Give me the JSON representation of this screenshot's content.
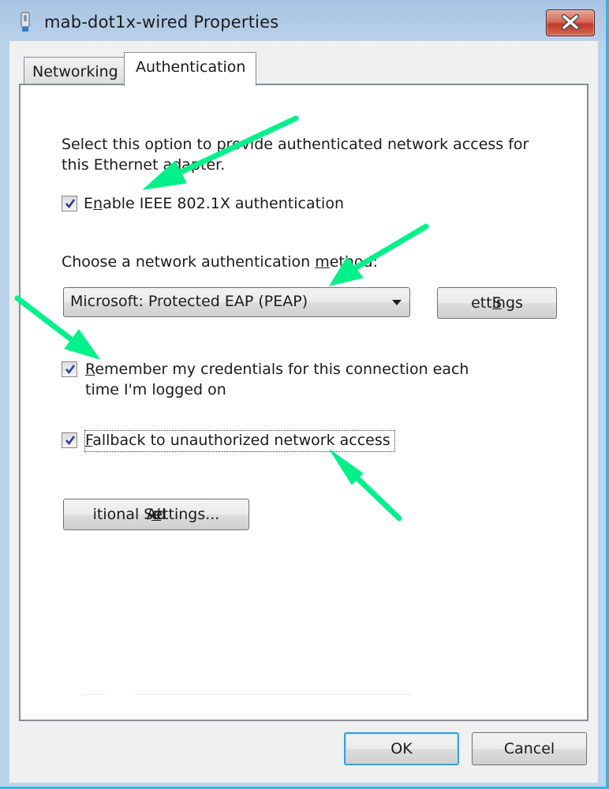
{
  "window": {
    "title": "mab-dot1x-wired Properties",
    "icon": "network-adapter-icon",
    "close_icon": "close-icon"
  },
  "tabs": [
    {
      "label": "Networking",
      "selected": false
    },
    {
      "label": "Authentication",
      "selected": true
    }
  ],
  "auth": {
    "description_line1": "Select this option to provide authenticated network access for",
    "description_line2": "this Ethernet adapter.",
    "enable_8021x": {
      "label_pre": "E",
      "label_accel": "n",
      "label_post": "able IEEE 802.1X authentication",
      "checked": true
    },
    "method_label_pre": "Choose a network authentication ",
    "method_label_accel": "m",
    "method_label_post": "ethod:",
    "method_selected": "Microsoft: Protected EAP (PEAP)",
    "settings_button": {
      "accel": "S",
      "rest": "ettings"
    },
    "remember_credentials": {
      "label_accel": "R",
      "label_line1_rest": "emember my credentials for this connection each",
      "label_line2": "time I'm logged on",
      "checked": true
    },
    "fallback": {
      "label_accel": "F",
      "label_rest": "allback to unauthorized network access",
      "checked": true
    },
    "additional_settings_button": {
      "pre": "Ad",
      "accel": "d",
      "post": "itional Settings..."
    }
  },
  "footer": {
    "ok_label": "OK",
    "cancel_label": "Cancel"
  },
  "annotations": {
    "arrow_color": "#00f08a",
    "count": 4
  }
}
